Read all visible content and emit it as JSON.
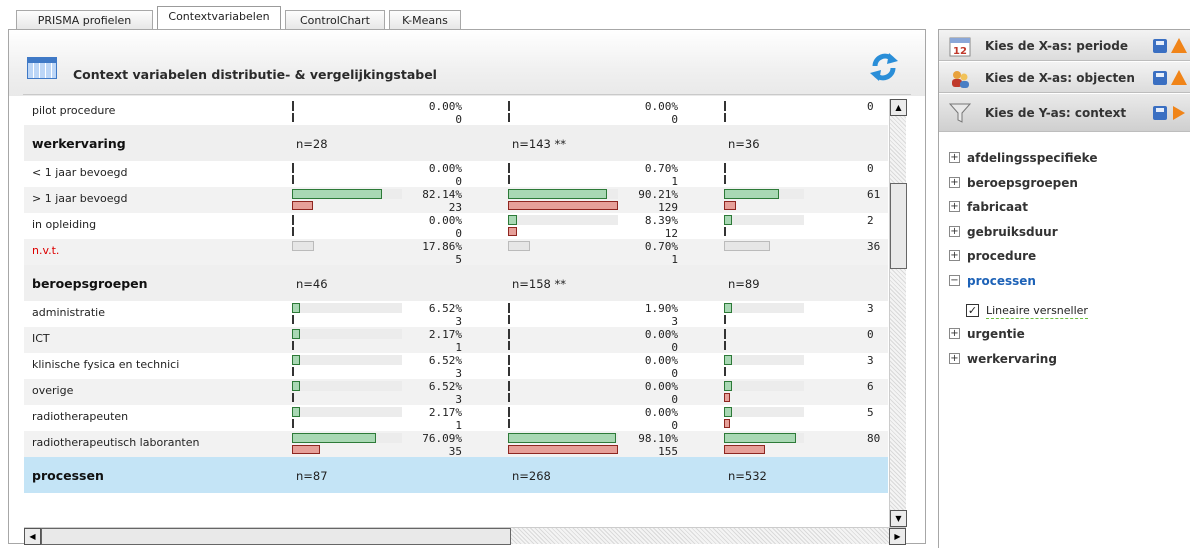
{
  "tabs": [
    {
      "label": "PRISMA profielen",
      "active": false
    },
    {
      "label": "Contextvariabelen",
      "active": true
    },
    {
      "label": "ControlChart",
      "active": false
    },
    {
      "label": "K-Means",
      "active": false
    }
  ],
  "panel": {
    "title": "Context variabelen distributie- & vergelijkingstabel",
    "icon": "calendar-grid-icon",
    "refresh_icon": "refresh-icon"
  },
  "table": {
    "rows": [
      {
        "type": "data",
        "label": "pilot procedure",
        "shade": false,
        "red": false,
        "c1": {
          "pct": "0.00%",
          "cnt": "0",
          "g": 0,
          "r": 0
        },
        "c2": {
          "pct": "0.00%",
          "cnt": "0",
          "g": 0,
          "r": 0
        },
        "c3": {
          "cnt": "0",
          "g": 0,
          "r": 0
        }
      },
      {
        "type": "section",
        "label": "werkervaring",
        "n": [
          "n=28",
          "n=143 **",
          "n=36"
        ]
      },
      {
        "type": "data",
        "label": "< 1 jaar bevoegd",
        "shade": false,
        "red": false,
        "c1": {
          "pct": "0.00%",
          "cnt": "0",
          "g": 0,
          "r": 0
        },
        "c2": {
          "pct": "0.70%",
          "cnt": "1",
          "g": 0,
          "r": 0
        },
        "c3": {
          "cnt": "0",
          "g": 0,
          "r": 0
        }
      },
      {
        "type": "data",
        "label": "> 1 jaar bevoegd",
        "shade": true,
        "red": false,
        "c1": {
          "pct": "82.14%",
          "cnt": "23",
          "g": 0.8214,
          "r": 0.19
        },
        "c2": {
          "pct": "90.21%",
          "cnt": "129",
          "g": 0.9021,
          "r": 1.0
        },
        "c3": {
          "cnt": "61",
          "g": 0.69,
          "r": 0.15
        }
      },
      {
        "type": "data",
        "label": "in opleiding",
        "shade": false,
        "red": false,
        "c1": {
          "pct": "0.00%",
          "cnt": "0",
          "g": 0,
          "r": 0
        },
        "c2": {
          "pct": "8.39%",
          "cnt": "12",
          "g": 0.0839,
          "r": 0.08
        },
        "c3": {
          "cnt": "2",
          "g": 0.02,
          "r": 0
        }
      },
      {
        "type": "data",
        "label": "n.v.t.",
        "shade": true,
        "red": true,
        "c1": {
          "pct": "17.86%",
          "cnt": "5",
          "g": 0,
          "r": 0
        },
        "c2": {
          "pct": "0.70%",
          "cnt": "1",
          "g": 0,
          "r": 0
        },
        "c3": {
          "cnt": "36",
          "g": 0,
          "r": 0
        }
      },
      {
        "type": "section",
        "label": "beroepsgroepen",
        "n": [
          "n=46",
          "n=158 **",
          "n=89"
        ]
      },
      {
        "type": "data",
        "label": "administratie",
        "shade": false,
        "red": false,
        "c1": {
          "pct": "6.52%",
          "cnt": "3",
          "g": 0.0652,
          "r": 0
        },
        "c2": {
          "pct": "1.90%",
          "cnt": "3",
          "g": 0,
          "r": 0
        },
        "c3": {
          "cnt": "3",
          "g": 0.02,
          "r": 0
        }
      },
      {
        "type": "data",
        "label": "ICT",
        "shade": true,
        "red": false,
        "c1": {
          "pct": "2.17%",
          "cnt": "1",
          "g": 0.0217,
          "r": 0
        },
        "c2": {
          "pct": "0.00%",
          "cnt": "0",
          "g": 0,
          "r": 0
        },
        "c3": {
          "cnt": "0",
          "g": 0,
          "r": 0
        }
      },
      {
        "type": "data",
        "label": "klinische fysica en technici",
        "shade": false,
        "red": false,
        "c1": {
          "pct": "6.52%",
          "cnt": "3",
          "g": 0.0652,
          "r": 0
        },
        "c2": {
          "pct": "0.00%",
          "cnt": "0",
          "g": 0,
          "r": 0
        },
        "c3": {
          "cnt": "3",
          "g": 0.02,
          "r": 0
        }
      },
      {
        "type": "data",
        "label": "overige",
        "shade": true,
        "red": false,
        "c1": {
          "pct": "6.52%",
          "cnt": "3",
          "g": 0.0652,
          "r": 0
        },
        "c2": {
          "pct": "0.00%",
          "cnt": "0",
          "g": 0,
          "r": 0
        },
        "c3": {
          "cnt": "6",
          "g": 0.07,
          "r": 0.03
        }
      },
      {
        "type": "data",
        "label": "radiotherapeuten",
        "shade": false,
        "red": false,
        "c1": {
          "pct": "2.17%",
          "cnt": "1",
          "g": 0.0217,
          "r": 0
        },
        "c2": {
          "pct": "0.00%",
          "cnt": "0",
          "g": 0,
          "r": 0
        },
        "c3": {
          "cnt": "5",
          "g": 0.06,
          "r": 0.03
        }
      },
      {
        "type": "data",
        "label": "radiotherapeutisch laboranten",
        "shade": true,
        "red": false,
        "c1": {
          "pct": "76.09%",
          "cnt": "35",
          "g": 0.7609,
          "r": 0.25
        },
        "c2": {
          "pct": "98.10%",
          "cnt": "155",
          "g": 0.981,
          "r": 1.0
        },
        "c3": {
          "cnt": "80",
          "g": 0.9,
          "r": 0.51
        }
      },
      {
        "type": "section",
        "label": "processen",
        "selected": true,
        "n": [
          "n=87",
          "n=268",
          "n=532"
        ]
      }
    ]
  },
  "right_panel": {
    "headers": [
      {
        "label": "Kies de X-as: periode",
        "icon": "calendar-12-icon",
        "action": "warning-icon"
      },
      {
        "label": "Kies de X-as: objecten",
        "icon": "users-icon",
        "action": "warning-icon"
      },
      {
        "label": "Kies de Y-as: context",
        "icon": "filter-funnel-icon",
        "action": "play-arrow-icon",
        "active": true
      }
    ],
    "tree": [
      {
        "label": "afdelingsspecifieke",
        "open": false
      },
      {
        "label": "beroepsgroepen",
        "open": false
      },
      {
        "label": "fabricaat",
        "open": false
      },
      {
        "label": "gebruiksduur",
        "open": false
      },
      {
        "label": "procedure",
        "open": false
      },
      {
        "label": "processen",
        "open": true,
        "children": [
          {
            "label": "Lineaire versneller",
            "checked": true
          }
        ]
      },
      {
        "label": "urgentie",
        "open": false
      },
      {
        "label": "werkervaring",
        "open": false
      }
    ]
  },
  "colors": {
    "green_bar": "#a9d8b4",
    "red_bar": "#e6a099",
    "selected_row": "#c4e4f6",
    "accent_orange": "#f08418"
  }
}
